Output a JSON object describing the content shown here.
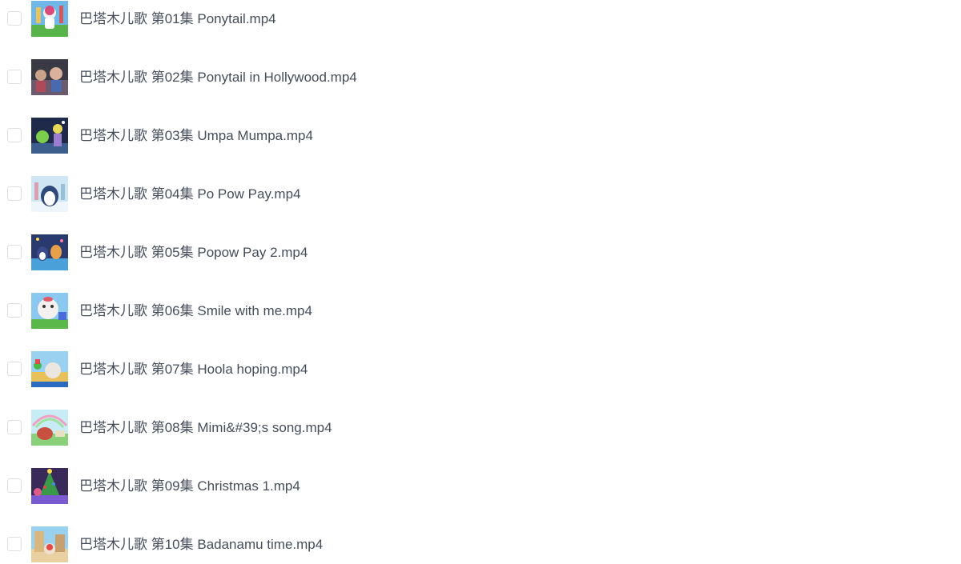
{
  "files": [
    {
      "name": "巴塔木儿歌 第01集 Ponytail.mp4",
      "thumbnail": "video-thumbnail",
      "checked": false
    },
    {
      "name": "巴塔木儿歌 第02集 Ponytail in Hollywood.mp4",
      "thumbnail": "video-thumbnail",
      "checked": false
    },
    {
      "name": "巴塔木儿歌 第03集 Umpa Mumpa.mp4",
      "thumbnail": "video-thumbnail",
      "checked": false
    },
    {
      "name": "巴塔木儿歌 第04集 Po Pow Pay.mp4",
      "thumbnail": "video-thumbnail",
      "checked": false
    },
    {
      "name": "巴塔木儿歌 第05集 Popow Pay 2.mp4",
      "thumbnail": "video-thumbnail",
      "checked": false
    },
    {
      "name": "巴塔木儿歌 第06集 Smile with me.mp4",
      "thumbnail": "video-thumbnail",
      "checked": false
    },
    {
      "name": "巴塔木儿歌 第07集 Hoola hoping.mp4",
      "thumbnail": "video-thumbnail",
      "checked": false
    },
    {
      "name": "巴塔木儿歌 第08集 Mimi&#39;s song.mp4",
      "thumbnail": "video-thumbnail",
      "checked": false
    },
    {
      "name": "巴塔木儿歌 第09集 Christmas 1.mp4",
      "thumbnail": "video-thumbnail",
      "checked": false
    },
    {
      "name": "巴塔木儿歌 第10集 Badanamu time.mp4",
      "thumbnail": "video-thumbnail",
      "checked": false
    }
  ],
  "colors": {
    "text": "#454d5a",
    "checkbox_border": "#dcdfe6",
    "background": "#ffffff"
  }
}
